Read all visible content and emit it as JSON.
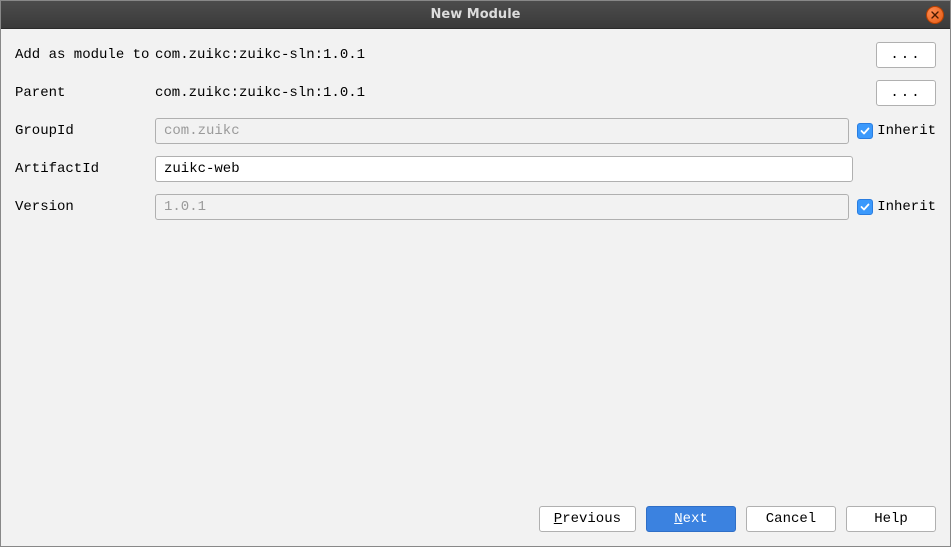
{
  "window": {
    "title": "New Module"
  },
  "form": {
    "addModule": {
      "label": "Add as module to",
      "value": "com.zuikc:zuikc-sln:1.0.1",
      "browse": "..."
    },
    "parent": {
      "label": "Parent",
      "value": "com.zuikc:zuikc-sln:1.0.1",
      "browse": "..."
    },
    "groupId": {
      "label": "GroupId",
      "value": "com.zuikc",
      "inherit_label": "Inherit"
    },
    "artifactId": {
      "label": "ArtifactId",
      "value": "zuikc-web"
    },
    "version": {
      "label": "Version",
      "value": "1.0.1",
      "inherit_label": "Inherit"
    }
  },
  "buttons": {
    "previous": "Previous",
    "next": "Next",
    "cancel": "Cancel",
    "help": "Help"
  }
}
